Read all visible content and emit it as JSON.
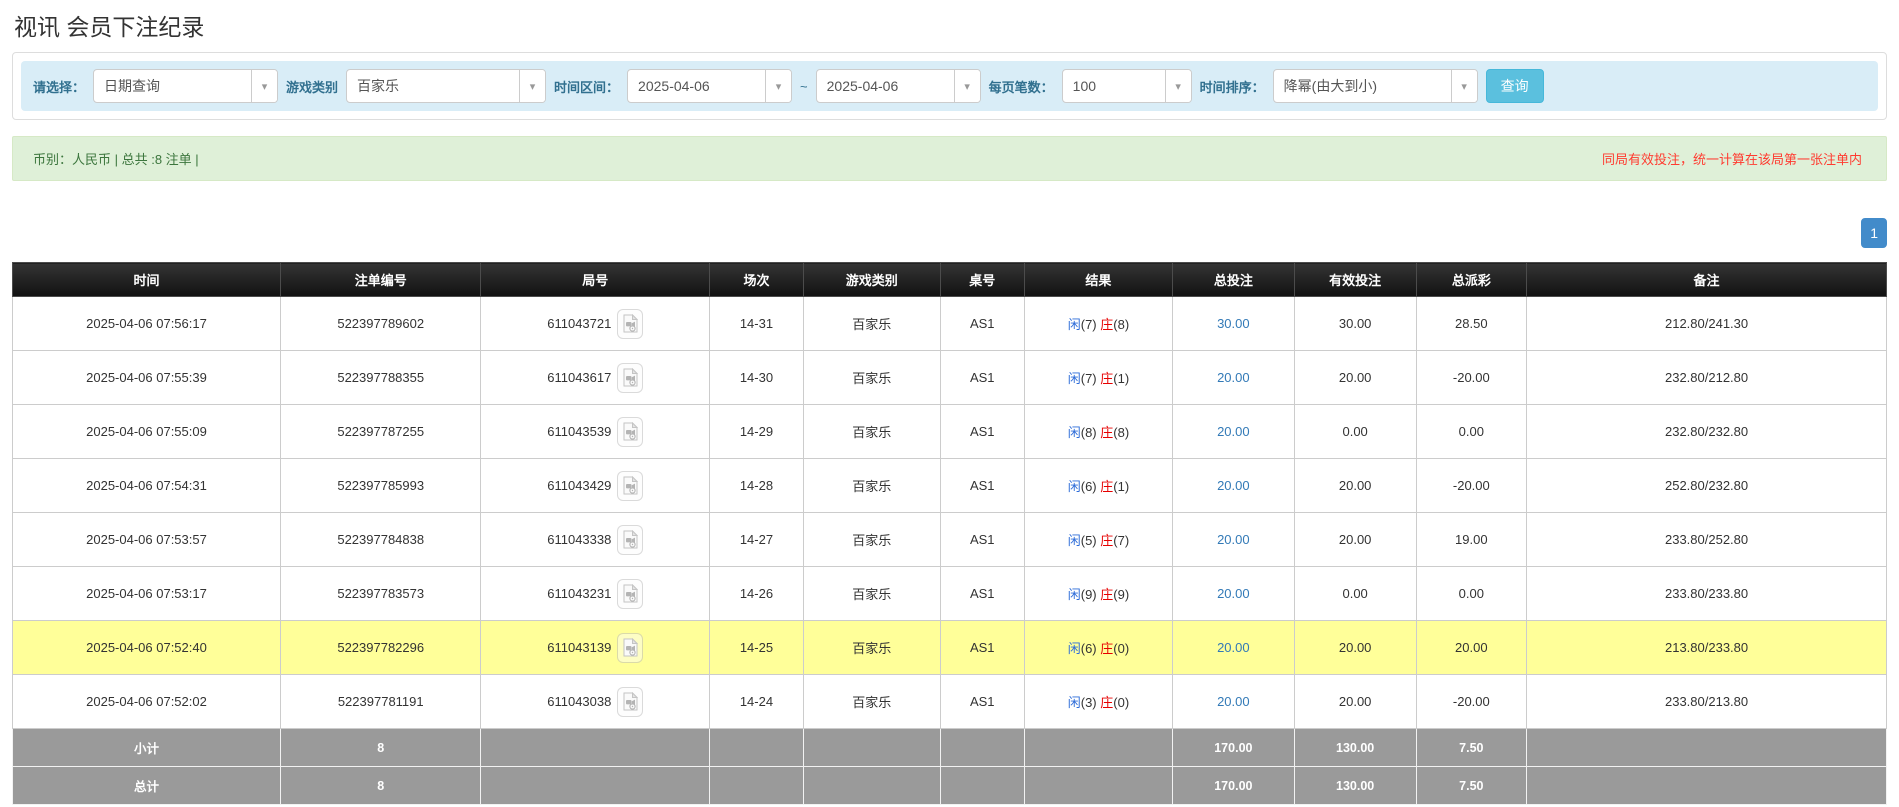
{
  "page": {
    "title": "视讯 会员下注纪录"
  },
  "filters": {
    "select_label": "请选择：",
    "select_value": "日期查询",
    "game_label": "游戏类别",
    "game_value": "百家乐",
    "range_label": "时间区间：",
    "date_from": "2025-04-06",
    "range_separator": "~",
    "date_to": "2025-04-06",
    "per_page_label": "每页笔数：",
    "per_page_value": "100",
    "sort_label": "时间排序：",
    "sort_value": "降幂(由大到小)",
    "search_button": "查询",
    "caret": "▾"
  },
  "summary": {
    "left": "币别：人民币 | 总共 :8 注单 |",
    "right": "同局有效投注，统一计算在该局第一张注单内"
  },
  "pagination": {
    "page": "1"
  },
  "table": {
    "headers": [
      "时间",
      "注单编号",
      "局号",
      "场次",
      "游戏类别",
      "桌号",
      "结果",
      "总投注",
      "有效投注",
      "总派彩",
      "备注"
    ],
    "rows": [
      {
        "time": "2025-04-06 07:56:17",
        "bet_id": "522397789602",
        "round_id": "611043721",
        "session": "14-31",
        "game": "百家乐",
        "table_no": "AS1",
        "player_label": "闲",
        "player_num": "(7)",
        "banker_label": "庄",
        "banker_num": "(8)",
        "total_bet": "30.00",
        "valid_bet": "30.00",
        "payout": "28.50",
        "remark": "212.80/241.30",
        "highlight": false
      },
      {
        "time": "2025-04-06 07:55:39",
        "bet_id": "522397788355",
        "round_id": "611043617",
        "session": "14-30",
        "game": "百家乐",
        "table_no": "AS1",
        "player_label": "闲",
        "player_num": "(7)",
        "banker_label": "庄",
        "banker_num": "(1)",
        "total_bet": "20.00",
        "valid_bet": "20.00",
        "payout": "-20.00",
        "remark": "232.80/212.80",
        "highlight": false
      },
      {
        "time": "2025-04-06 07:55:09",
        "bet_id": "522397787255",
        "round_id": "611043539",
        "session": "14-29",
        "game": "百家乐",
        "table_no": "AS1",
        "player_label": "闲",
        "player_num": "(8)",
        "banker_label": "庄",
        "banker_num": "(8)",
        "total_bet": "20.00",
        "valid_bet": "0.00",
        "payout": "0.00",
        "remark": "232.80/232.80",
        "highlight": false
      },
      {
        "time": "2025-04-06 07:54:31",
        "bet_id": "522397785993",
        "round_id": "611043429",
        "session": "14-28",
        "game": "百家乐",
        "table_no": "AS1",
        "player_label": "闲",
        "player_num": "(6)",
        "banker_label": "庄",
        "banker_num": "(1)",
        "total_bet": "20.00",
        "valid_bet": "20.00",
        "payout": "-20.00",
        "remark": "252.80/232.80",
        "highlight": false
      },
      {
        "time": "2025-04-06 07:53:57",
        "bet_id": "522397784838",
        "round_id": "611043338",
        "session": "14-27",
        "game": "百家乐",
        "table_no": "AS1",
        "player_label": "闲",
        "player_num": "(5)",
        "banker_label": "庄",
        "banker_num": "(7)",
        "total_bet": "20.00",
        "valid_bet": "20.00",
        "payout": "19.00",
        "remark": "233.80/252.80",
        "highlight": false
      },
      {
        "time": "2025-04-06 07:53:17",
        "bet_id": "522397783573",
        "round_id": "611043231",
        "session": "14-26",
        "game": "百家乐",
        "table_no": "AS1",
        "player_label": "闲",
        "player_num": "(9)",
        "banker_label": "庄",
        "banker_num": "(9)",
        "total_bet": "20.00",
        "valid_bet": "0.00",
        "payout": "0.00",
        "remark": "233.80/233.80",
        "highlight": false
      },
      {
        "time": "2025-04-06 07:52:40",
        "bet_id": "522397782296",
        "round_id": "611043139",
        "session": "14-25",
        "game": "百家乐",
        "table_no": "AS1",
        "player_label": "闲",
        "player_num": "(6)",
        "banker_label": "庄",
        "banker_num": "(0)",
        "total_bet": "20.00",
        "valid_bet": "20.00",
        "payout": "20.00",
        "remark": "213.80/233.80",
        "highlight": true
      },
      {
        "time": "2025-04-06 07:52:02",
        "bet_id": "522397781191",
        "round_id": "611043038",
        "session": "14-24",
        "game": "百家乐",
        "table_no": "AS1",
        "player_label": "闲",
        "player_num": "(3)",
        "banker_label": "庄",
        "banker_num": "(0)",
        "total_bet": "20.00",
        "valid_bet": "20.00",
        "payout": "-20.00",
        "remark": "233.80/213.80",
        "highlight": false
      }
    ],
    "subtotal": {
      "label": "小计",
      "count": "8",
      "total_bet": "170.00",
      "valid_bet": "130.00",
      "payout": "7.50"
    },
    "total": {
      "label": "总计",
      "count": "8",
      "total_bet": "170.00",
      "valid_bet": "130.00",
      "payout": "7.50"
    }
  },
  "colors": {
    "header_bg": "#1c1c1c",
    "highlight_row": "#ffff99",
    "subtotal_bg": "#9a9a9a",
    "link_blue": "#337ab7",
    "player_blue": "#2e6dd9",
    "banker_red": "#e60000",
    "negative_red": "#ff0000",
    "search_button_teal": "#5bc0de",
    "pagination_blue": "#428bca",
    "summary_bg_green": "#dff0d8",
    "summary_text_green": "#3c763d",
    "note_red": "#ff3b30",
    "filter_bar_bg": "#d9edf7",
    "filter_label": "#31708f"
  }
}
